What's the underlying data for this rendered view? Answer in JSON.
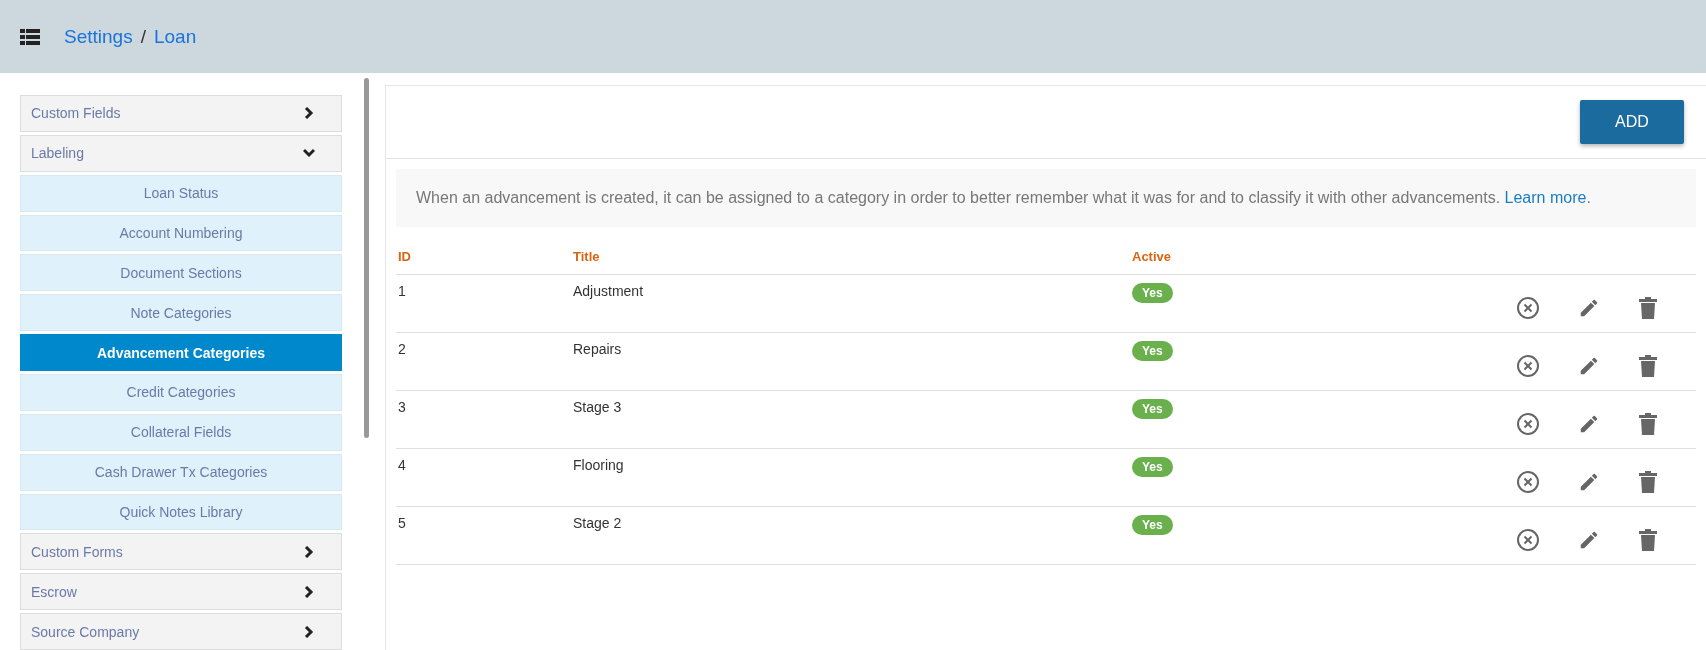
{
  "breadcrumb": [
    "Settings",
    "Loan"
  ],
  "breadcrumb_separator": "/",
  "sidebar": {
    "items": [
      {
        "label": "Custom Fields",
        "expanded": false
      },
      {
        "label": "Labeling",
        "expanded": true,
        "children": [
          {
            "label": "Loan Status",
            "selected": false
          },
          {
            "label": "Account Numbering",
            "selected": false
          },
          {
            "label": "Document Sections",
            "selected": false
          },
          {
            "label": "Note Categories",
            "selected": false
          },
          {
            "label": "Advancement Categories",
            "selected": true
          },
          {
            "label": "Credit Categories",
            "selected": false
          },
          {
            "label": "Collateral Fields",
            "selected": false
          },
          {
            "label": "Cash Drawer Tx Categories",
            "selected": false
          },
          {
            "label": "Quick Notes Library",
            "selected": false
          }
        ]
      },
      {
        "label": "Custom Forms",
        "expanded": false
      },
      {
        "label": "Escrow",
        "expanded": false
      },
      {
        "label": "Source Company",
        "expanded": false
      }
    ]
  },
  "add_button": "ADD",
  "info": {
    "text": "When an advancement is created, it can be assigned to a category in order to better remember what it was for and to classify it with other advancements.",
    "link": "Learn more",
    "after": "."
  },
  "table": {
    "columns": [
      "ID",
      "Title",
      "Active"
    ],
    "rows": [
      {
        "id": "1",
        "title": "Adjustment",
        "active": "Yes"
      },
      {
        "id": "2",
        "title": "Repairs",
        "active": "Yes"
      },
      {
        "id": "3",
        "title": "Stage 3",
        "active": "Yes"
      },
      {
        "id": "4",
        "title": "Flooring",
        "active": "Yes"
      },
      {
        "id": "5",
        "title": "Stage 2",
        "active": "Yes"
      }
    ]
  }
}
